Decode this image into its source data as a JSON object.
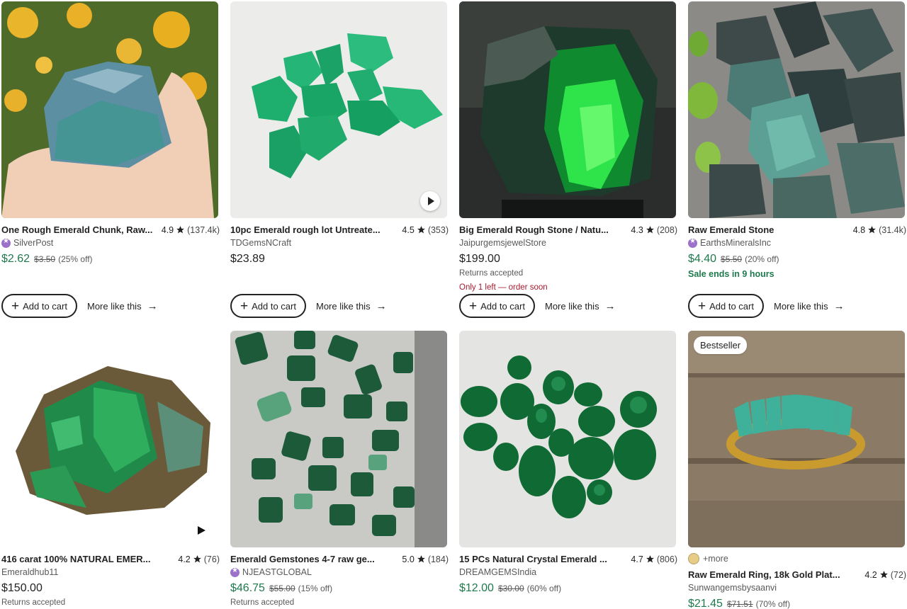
{
  "listings": [
    {
      "title": "One Rough Emerald Chunk, Raw...",
      "rating": "4.9",
      "reviews": "(137.4k)",
      "shop": "SilverPost",
      "star_seller": true,
      "price": "$2.62",
      "orig": "$3.50",
      "pct": "(25% off)",
      "add_label": "Add to cart",
      "more_label": "More like this"
    },
    {
      "title": "10pc Emerald rough lot Untreate...",
      "rating": "4.5",
      "reviews": "(353)",
      "shop": "TDGemsNCraft",
      "price": "$23.89",
      "add_label": "Add to cart",
      "more_label": "More like this"
    },
    {
      "title": "Big Emerald Rough Stone / Natu...",
      "rating": "4.3",
      "reviews": "(208)",
      "shop": "JaipurgemsjewelStore",
      "price": "$199.00",
      "note1": "Returns accepted",
      "note2": "Only 1 left — order soon",
      "add_label": "Add to cart",
      "more_label": "More like this"
    },
    {
      "title": "Raw Emerald Stone",
      "rating": "4.8",
      "reviews": "(31.4k)",
      "shop": "EarthsMineralsInc",
      "star_seller": true,
      "price": "$4.40",
      "orig": "$5.50",
      "pct": "(20% off)",
      "note1": "Sale ends in 9 hours",
      "add_label": "Add to cart",
      "more_label": "More like this"
    },
    {
      "title": "416 carat 100% NATURAL EMER...",
      "rating": "4.2",
      "reviews": "(76)",
      "shop": "Emeraldhub11",
      "price": "$150.00",
      "note1": "Returns accepted"
    },
    {
      "title": "Emerald Gemstones 4-7 raw ge...",
      "rating": "5.0",
      "reviews": "(184)",
      "shop": "NJEASTGLOBAL",
      "star_seller": true,
      "price": "$46.75",
      "orig": "$55.00",
      "pct": "(15% off)",
      "note1": "Returns accepted"
    },
    {
      "title": "15 PCs Natural Crystal Emerald ...",
      "rating": "4.7",
      "reviews": "(806)",
      "shop": "DREAMGEMSIndia",
      "price": "$12.00",
      "orig": "$30.00",
      "pct": "(60% off)"
    },
    {
      "title": "Raw Emerald Ring, 18k Gold Plat...",
      "rating": "4.2",
      "reviews": "(72)",
      "shop": "Sunwangemsbysaanvi",
      "price": "$21.45",
      "orig": "$71.51",
      "pct": "(70% off)",
      "badge": "Bestseller",
      "plus_more": "+more"
    }
  ],
  "colors": {
    "sale_green": "#1e7a4d",
    "urgent_red": "#a61a2e",
    "star_seller_purple": "#9b71c9"
  },
  "icons": {
    "star": "star-icon",
    "play": "play-icon",
    "plus": "plus-icon",
    "arrow": "arrow-right-icon"
  }
}
